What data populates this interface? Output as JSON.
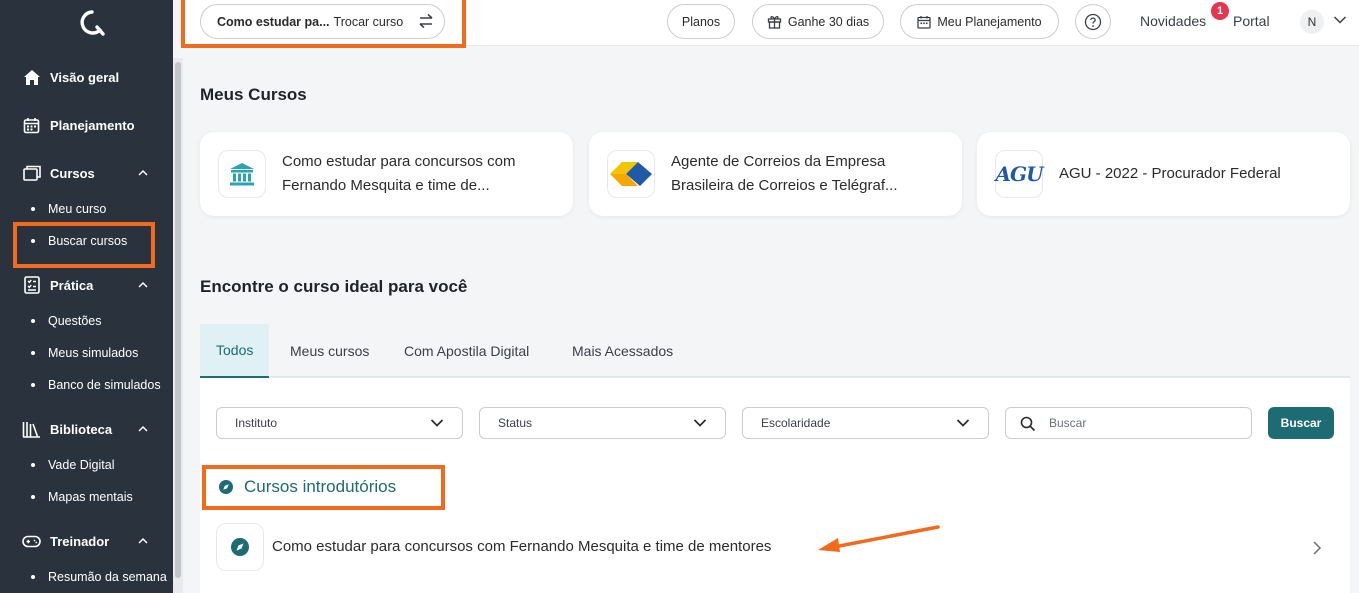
{
  "sidebar": {
    "nav": [
      {
        "label": "Visão geral",
        "icon": "home-icon"
      },
      {
        "label": "Planejamento",
        "icon": "calendar-icon"
      },
      {
        "label": "Cursos",
        "icon": "courses-icon",
        "expanded": true,
        "children": [
          "Meu curso",
          "Buscar cursos"
        ]
      },
      {
        "label": "Prática",
        "icon": "practice-icon",
        "expanded": true,
        "children": [
          "Questões",
          "Meus simulados",
          "Banco de simulados"
        ]
      },
      {
        "label": "Biblioteca",
        "icon": "library-icon",
        "expanded": true,
        "children": [
          "Vade Digital",
          "Mapas mentais"
        ]
      },
      {
        "label": "Treinador",
        "icon": "gamepad-icon",
        "expanded": true,
        "children": [
          "Resumão da semana"
        ]
      }
    ]
  },
  "topbar": {
    "course_name": "Como estudar pa...",
    "switch_label": "Trocar curso",
    "plans_label": "Planos",
    "gift_label": "Ganhe 30 dias",
    "planner_label": "Meu Planejamento",
    "news_label": "Novidades",
    "news_count": "1",
    "portal_label": "Portal",
    "user_initial": "N"
  },
  "my_courses": {
    "heading": "Meus Cursos",
    "cards": [
      {
        "title": "Como estudar para concursos com Fernando Mesquita e time de...",
        "icon": "institution-icon"
      },
      {
        "title": "Agente de Correios da Empresa Brasileira de Correios e Telégraf...",
        "icon": "correios-logo"
      },
      {
        "title": "AGU - 2022 - Procurador Federal",
        "icon": "agu-logo",
        "logo_text": "AGU"
      }
    ]
  },
  "find": {
    "heading": "Encontre o curso ideal para você",
    "tabs": [
      "Todos",
      "Meus cursos",
      "Com Apostila Digital",
      "Mais Acessados"
    ],
    "filters": {
      "instituto": "Instituto",
      "status": "Status",
      "escolaridade": "Escolaridade",
      "search_placeholder": "Buscar",
      "search_button": "Buscar"
    },
    "section_title": "Cursos introdutórios",
    "intro_course": "Como estudar para concursos com Fernando Mesquita e time de mentores"
  },
  "colors": {
    "accent": "#1d6b73",
    "sidebar_bg": "#2a323e",
    "highlight": "#f26a1b",
    "badge": "#e5364f"
  }
}
